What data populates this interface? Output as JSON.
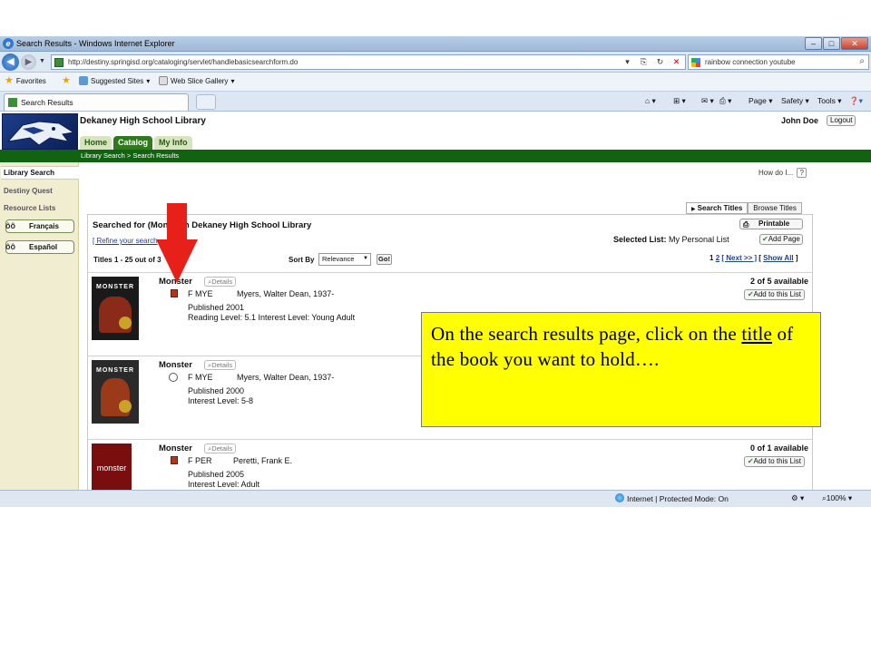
{
  "window": {
    "title": "Search Results - Windows Internet Explorer",
    "url": "http://destiny.springisd.org/cataloging/servlet/handlebasicsearchform.do",
    "search_query": "rainbow connection youtube"
  },
  "favorites_bar": {
    "favorites": "Favorites",
    "suggested_sites": "Suggested Sites",
    "web_slice_gallery": "Web Slice Gallery"
  },
  "tab_bar": {
    "active_tab": "Search Results",
    "page_menu": "Page",
    "safety_menu": "Safety",
    "tools_menu": "Tools"
  },
  "site": {
    "school_name": "Dekaney High School Library",
    "user_name": "John Doe",
    "logout": "Logout",
    "tabs": [
      "Home",
      "Catalog",
      "My Info"
    ],
    "breadcrumb": "Library Search > Search Results",
    "how_do_i": "How do I...",
    "how_do_i_q": "?"
  },
  "sidebar": {
    "items": [
      "Library Search",
      "Destiny Quest",
      "Resource Lists"
    ],
    "languages": [
      "Français",
      "Español"
    ]
  },
  "results": {
    "view_tabs": [
      "Search Titles",
      "Browse Titles"
    ],
    "searched_for_a": "Searched for (Mon",
    "searched_for_b": "er) in Dekaney High School Library",
    "refine": "[ Refine your search",
    "printable": "Printable",
    "selected_list_label": "Selected List:",
    "selected_list_value": "My Personal List",
    "add_page": "Add Page",
    "titles_count": "Titles 1 - 25 out of 3",
    "sort_by": "Sort By",
    "sort_value": "Relevance",
    "go": "Go!",
    "pager_pages": "1",
    "pager_page2": "2",
    "pager_next": "[ Next >> ]",
    "pager_showall": "Show All",
    "add_to_list": "Add to this List",
    "details": "Details",
    "items": [
      {
        "title": "Monster",
        "call_no": "F MYE",
        "author": "Myers, Walter Dean, 1937-",
        "published": "Published 2001",
        "level": "Reading Level: 5.1   Interest Level: Young Adult",
        "availability": "2 of 5 available",
        "cover_text": "MONSTER",
        "cover_color": "#1a1a1a"
      },
      {
        "title": "Monster",
        "call_no": "F MYE",
        "author": "Myers, Walter Dean, 1937-",
        "published": "Published 2000",
        "level": "Interest Level: 5-8",
        "availability": "",
        "cover_text": "MONSTER",
        "cover_color": "#2a2a2a"
      },
      {
        "title": "Monster",
        "call_no": "F PER",
        "author": "Peretti, Frank E.",
        "published": "Published 2005",
        "level": "Interest Level: Adult",
        "availability": "0 of 1 available",
        "cover_text": "monster",
        "cover_color": "#7a0e0e"
      }
    ]
  },
  "status_bar": {
    "zone": "Internet | Protected Mode: On",
    "zoom": "100%"
  },
  "callout": {
    "text_before": "On the search results page, click on the ",
    "text_underlined": "title",
    "text_after": " of the book you want to hold…."
  },
  "colors": {
    "accent_green": "#116311",
    "callout_yellow": "#ffff00",
    "arrow_red": "#e8201a"
  }
}
